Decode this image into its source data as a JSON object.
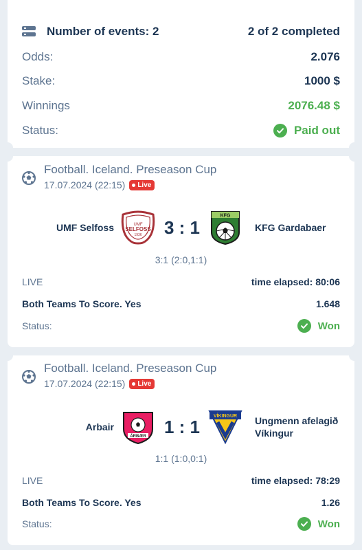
{
  "summary": {
    "events_label": "Number of events: 2",
    "completed": "2 of 2 completed",
    "odds_label": "Odds:",
    "odds_value": "2.076",
    "stake_label": "Stake:",
    "stake_value": "1000 $",
    "winnings_label": "Winnings",
    "winnings_value": "2076.48 $",
    "status_label": "Status:",
    "status_value": "Paid out"
  },
  "events": [
    {
      "title": "Football. Iceland. Preseason Cup",
      "date": "17.07.2024 (22:15)",
      "live_badge": "Live",
      "home": "UMF Selfoss",
      "away": "KFG Gardabaer",
      "score": "3 : 1",
      "subscore": "3:1 (2:0,1:1)",
      "state": "LIVE",
      "elapsed": "time elapsed: 80:06",
      "market": "Both Teams To Score. Yes",
      "odds": "1.648",
      "status_label": "Status:",
      "status_value": "Won",
      "home_logo_text": "UMF SELFOSS 1936",
      "away_logo_text": "KFG"
    },
    {
      "title": "Football. Iceland. Preseason Cup",
      "date": "17.07.2024 (22:15)",
      "live_badge": "Live",
      "home": "Arbair",
      "away": "Ungmenn afelagið Víkingur",
      "score": "1 : 1",
      "subscore": "1:1 (1:0,0:1)",
      "state": "LIVE",
      "elapsed": "time elapsed: 78:29",
      "market": "Both Teams To Score. Yes",
      "odds": "1.26",
      "status_label": "Status:",
      "status_value": "Won",
      "home_logo_text": "ÁRBÆR",
      "away_logo_text": "UMF VÍKINGUR"
    }
  ],
  "colors": {
    "background": "#e9eef3",
    "text": "#1c3553",
    "muted": "#5d7490",
    "green": "#4caf50",
    "live": "#e53935"
  }
}
